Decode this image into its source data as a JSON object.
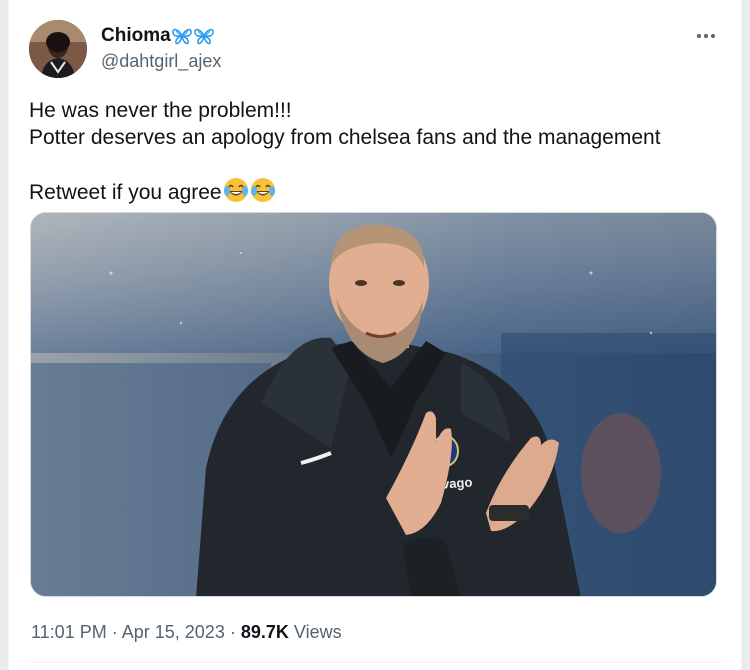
{
  "tweet": {
    "author": {
      "display_name": "Chioma",
      "handle": "@dahtgirl_ajex",
      "name_emoji": "butterfly-icon"
    },
    "text_lines": [
      "He was never the problem!!!",
      "Potter deserves an apology from chelsea fans and the management",
      "Retweet if you agree"
    ],
    "text_emoji": "face-with-tears-of-joy-icon",
    "photo": {
      "jersey_sponsor": "trivago"
    },
    "time": "11:01 PM",
    "separator": "·",
    "date": "Apr 15, 2023",
    "views_count": "89.7K",
    "views_label": "Views"
  },
  "colors": {
    "text": "#0f1419",
    "secondary": "#536471",
    "butterfly": "#1d9bf0",
    "jacket": "#22272d"
  }
}
